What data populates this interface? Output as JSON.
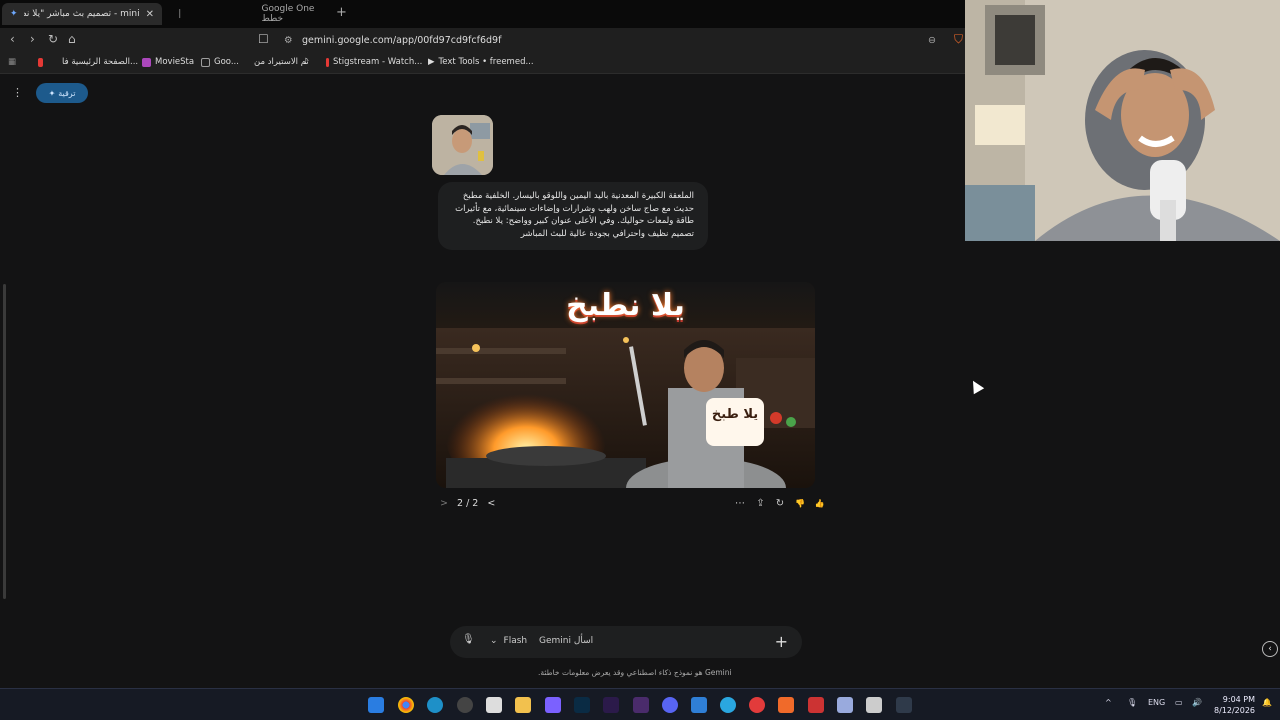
{
  "tabs": [
    {
      "title": "mini - تصميم بث مباشر \"يلا نطبخ\"",
      "active": true,
      "close": "✕"
    },
    {
      "title": "Google One خطط",
      "active": false
    }
  ],
  "newtab": "+",
  "url": "gemini.google.com/app/00fd97cd9fcf6d9f",
  "bookmarks": [
    {
      "label": "الصفحة الرئيسية فا...",
      "icon_color": "#e53935"
    },
    {
      "label": "MovieSta",
      "icon_color": "#ab47bc"
    },
    {
      "label": "Goo...",
      "icon_color": "#9e9e9e"
    },
    {
      "label": "تم الاستيراد من",
      "icon_color": "#9e9e9e"
    },
    {
      "label": "Stigstream - Watch...",
      "icon_color": "#e53935"
    },
    {
      "label": "Text Tools • freemed...",
      "icon_color": "#eeeeee"
    }
  ],
  "upgrade_label": "ترقية",
  "user_prompt": "الملعقة الكبيرة المعدنية باليد اليمين واللوقو باليسار. الخلفية مطبخ حديث مع صاج ساخن ولهب وشرارات وإضاءات سينمائية، مع تأثيرات طاقة ولمعات حواليك. وفي الأعلى عنوان كبير وواضح: يلا نطبخ. تصميم نظيف واحترافي بجودة عالية للبث المباشر",
  "image": {
    "title": "يلا نطبخ",
    "sign_text": "يلا طبخ"
  },
  "pager": {
    "text": "2 / 2",
    "prev": "<",
    "next": ">"
  },
  "actions": [
    "⋯",
    "⇪",
    "↻",
    "👎",
    "👍"
  ],
  "prompt": {
    "placeholder": "اسأل Gemini",
    "model": "Flash",
    "plus": "+",
    "mic": "🎙"
  },
  "disclaimer": "Gemini هو نموذج ذكاء اصطناعي وقد يعرض معلومات خاطئة.",
  "tray": {
    "lang": "ENG",
    "time": "9:04 PM",
    "date": "8/12/2026"
  },
  "colors": {
    "accent": "#1d5a8c",
    "bg": "#131314",
    "bubble": "#1e1f20"
  }
}
